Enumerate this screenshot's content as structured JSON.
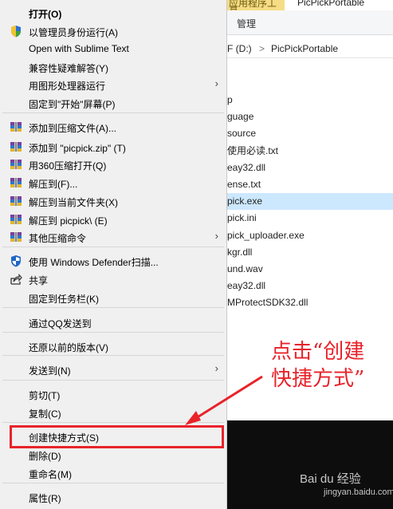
{
  "explorer": {
    "ribbon_tab": "应用程序工具",
    "title": "PicPickPortable",
    "manage_tab": "管理",
    "address": {
      "drive": "F (D:)",
      "separator": ">",
      "folder": "PicPickPortable"
    },
    "files": [
      "p",
      "guage",
      "source",
      "使用必读.txt",
      "eay32.dll",
      "ense.txt",
      "pick.exe",
      "pick.ini",
      "pick_uploader.exe",
      "kgr.dll",
      "und.wav",
      "eay32.dll",
      "MProtectSDK32.dll"
    ],
    "selected_file_index": 6
  },
  "menu": {
    "items": [
      {
        "label": "打开(O)",
        "icon": "none",
        "bold": true
      },
      {
        "label": "以管理员身份运行(A)",
        "icon": "uac-shield-icon"
      },
      {
        "label": "Open with Sublime Text",
        "icon": "none"
      },
      {
        "label": "兼容性疑难解答(Y)",
        "icon": "none"
      },
      {
        "label": "用图形处理器运行",
        "icon": "none",
        "submenu": true
      },
      {
        "label": "固定到\"开始\"屏幕(P)",
        "icon": "none"
      },
      {
        "label": "添加到压缩文件(A)...",
        "icon": "archive-icon"
      },
      {
        "label": "添加到 \"picpick.zip\" (T)",
        "icon": "archive-icon"
      },
      {
        "label": "用360压缩打开(Q)",
        "icon": "archive-icon"
      },
      {
        "label": "解压到(F)...",
        "icon": "archive-icon"
      },
      {
        "label": "解压到当前文件夹(X)",
        "icon": "archive-icon"
      },
      {
        "label": "解压到 picpick\\ (E)",
        "icon": "archive-icon"
      },
      {
        "label": "其他压缩命令",
        "icon": "archive-icon",
        "submenu": true
      },
      {
        "label": "使用 Windows Defender扫描...",
        "icon": "defender-icon"
      },
      {
        "label": "共享",
        "icon": "share-icon"
      },
      {
        "label": "固定到任务栏(K)",
        "icon": "none"
      },
      {
        "label": "通过QQ发送到",
        "icon": "none"
      },
      {
        "label": "还原以前的版本(V)",
        "icon": "none"
      },
      {
        "label": "发送到(N)",
        "icon": "none",
        "submenu": true
      },
      {
        "label": "剪切(T)",
        "icon": "none"
      },
      {
        "label": "复制(C)",
        "icon": "none"
      },
      {
        "label": "创建快捷方式(S)",
        "icon": "none",
        "highlighted": true
      },
      {
        "label": "删除(D)",
        "icon": "none"
      },
      {
        "label": "重命名(M)",
        "icon": "none"
      },
      {
        "label": "属性(R)",
        "icon": "none"
      }
    ],
    "submenu_glyph": "›"
  },
  "annotation": {
    "line1": "点击“创建",
    "line2": "快捷方式”",
    "color": "#e8232a"
  },
  "watermark": {
    "brand": "Bai du 经验",
    "url": "jingyan.baidu.com"
  }
}
